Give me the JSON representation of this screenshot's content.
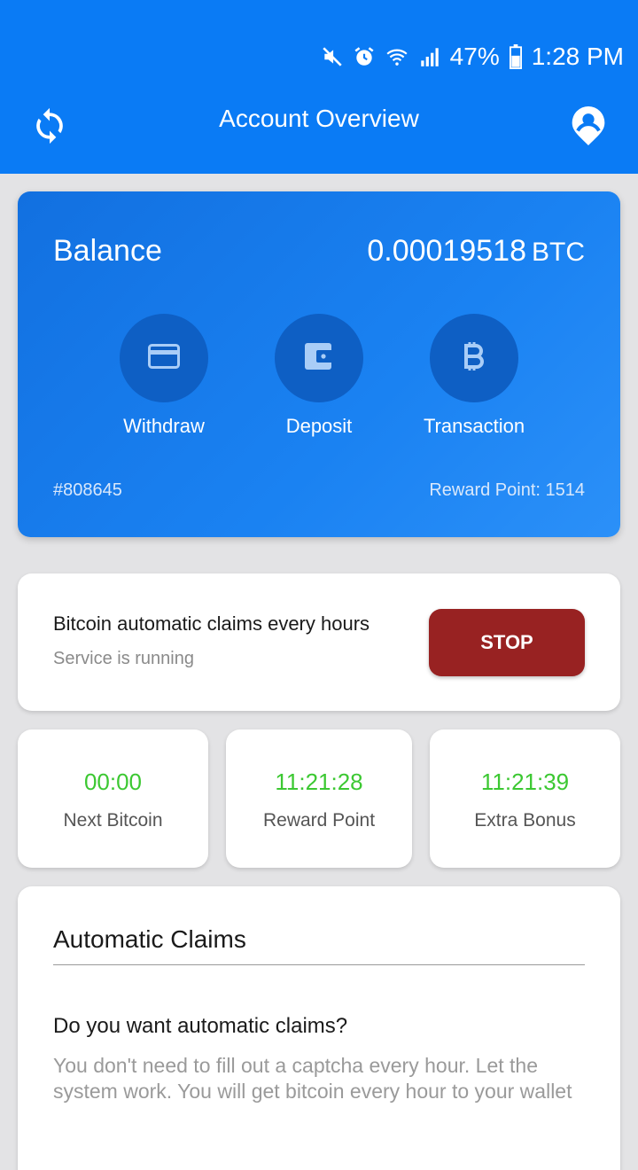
{
  "status_bar": {
    "battery": "47%",
    "time": "1:28 PM",
    "icons": [
      "mute-icon",
      "alarm-icon",
      "wifi-icon",
      "signal-icon",
      "battery-icon"
    ]
  },
  "toolbar": {
    "title": "Account Overview",
    "left_icon": "refresh-icon",
    "right_icon": "account-icon"
  },
  "balance_card": {
    "label": "Balance",
    "amount": "0.00019518",
    "unit": "BTC",
    "actions": [
      {
        "label": "Withdraw",
        "icon": "credit-card-icon"
      },
      {
        "label": "Deposit",
        "icon": "wallet-icon"
      },
      {
        "label": "Transaction",
        "icon": "bitcoin-icon"
      }
    ],
    "account_id": "#808645",
    "reward_points": "Reward Point: 1514"
  },
  "service": {
    "title": "Bitcoin automatic claims every hours",
    "status": "Service is running",
    "button_label": "STOP"
  },
  "timers": [
    {
      "value": "00:00",
      "label": "Next Bitcoin"
    },
    {
      "value": "11:21:28",
      "label": "Reward Point"
    },
    {
      "value": "11:21:39",
      "label": "Extra Bonus"
    }
  ],
  "claims": {
    "heading": "Automatic Claims",
    "question": "Do you want automatic claims?",
    "description": "You don't need to fill out a captcha every hour. Let the system work. You will get bitcoin every hour to your wallet"
  },
  "colors": {
    "app_bar": "#0a7bf5",
    "action_circle": "#0e5fc4",
    "stop_button": "#982222",
    "timer_value": "#3cc832"
  }
}
